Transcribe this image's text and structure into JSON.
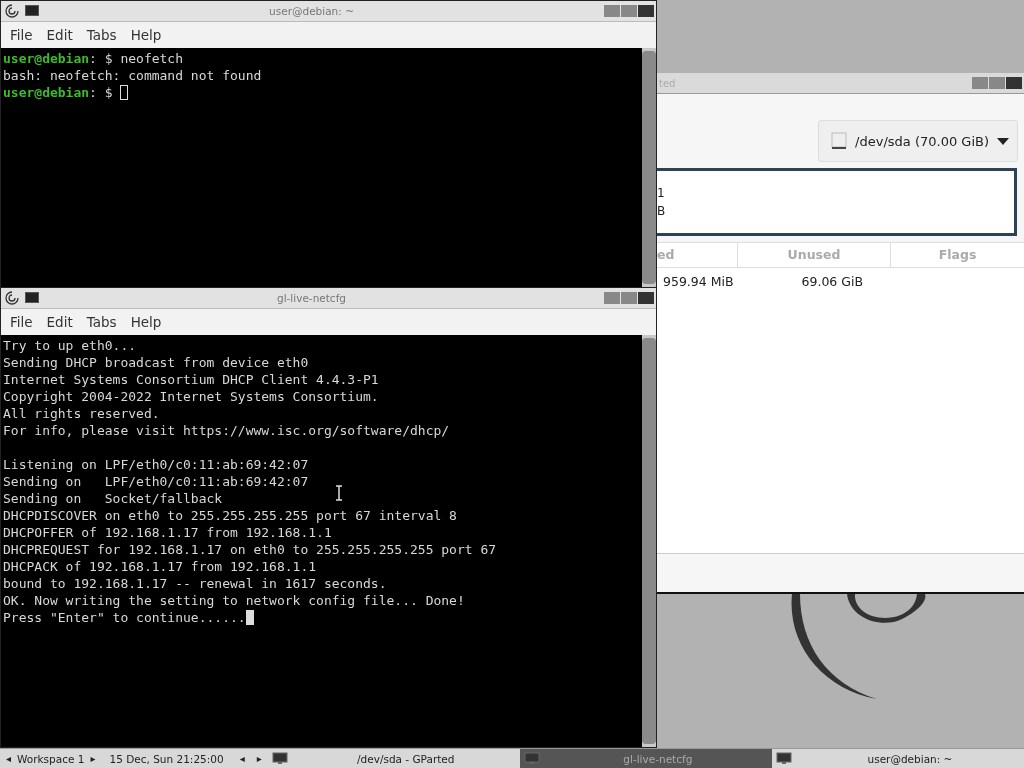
{
  "terminals": [
    {
      "title": "user@debian: ~",
      "menu": [
        "File",
        "Edit",
        "Tabs",
        "Help"
      ],
      "focused": false,
      "lines": [
        {
          "prompt": "user@debian",
          "text": ": $ neofetch"
        },
        {
          "text": "bash: neofetch: command not found"
        },
        {
          "prompt": "user@debian",
          "text": ": $ "
        }
      ]
    },
    {
      "title": "gl-live-netcfg",
      "menu": [
        "File",
        "Edit",
        "Tabs",
        "Help"
      ],
      "focused": true,
      "lines": [
        {
          "text": "Try to up eth0..."
        },
        {
          "text": "Sending DHCP broadcast from device eth0"
        },
        {
          "text": "Internet Systems Consortium DHCP Client 4.4.3-P1"
        },
        {
          "text": "Copyright 2004-2022 Internet Systems Consortium."
        },
        {
          "text": "All rights reserved."
        },
        {
          "text": "For info, please visit https://www.isc.org/software/dhcp/"
        },
        {
          "text": "Listening on LPF/eth0/c0:11:ab:69:42:07",
          "space_before": true
        },
        {
          "text": "Sending on   LPF/eth0/c0:11:ab:69:42:07"
        },
        {
          "text": "Sending on   Socket/fallback"
        },
        {
          "text": "DHCPDISCOVER on eth0 to 255.255.255.255 port 67 interval 8"
        },
        {
          "text": "DHCPOFFER of 192.168.1.17 from 192.168.1.1"
        },
        {
          "text": "DHCPREQUEST for 192.168.1.17 on eth0 to 255.255.255.255 port 67"
        },
        {
          "text": "DHCPACK of 192.168.1.17 from 192.168.1.1"
        },
        {
          "text": "bound to 192.168.1.17 -- renewal in 1617 seconds."
        },
        {
          "text": "OK. Now writing the setting to network config file... Done!"
        },
        {
          "text": "Press \"Enter\" to continue......"
        }
      ]
    }
  ],
  "gparted": {
    "title": "ted",
    "device": "/dev/sda (70.00 GiB)",
    "graph_lines": [
      "1",
      "B"
    ],
    "columns": [
      "ed",
      "Unused",
      "Flags"
    ],
    "rows": [
      [
        "959.94 MiB",
        "69.06 GiB",
        ""
      ]
    ]
  },
  "taskbar": {
    "prev_arrow": "◂",
    "workspace": "Workspace 1",
    "next_arrow": "▸",
    "task_prev": "◂",
    "task_next": "▸",
    "clock": "15 Dec, Sun 21:25:00",
    "tasks": [
      {
        "label": "/dev/sda - GParted",
        "selected": false
      },
      {
        "label": "gl-live-netcfg",
        "selected": true
      },
      {
        "label": "user@debian: ~",
        "selected": false
      }
    ]
  }
}
